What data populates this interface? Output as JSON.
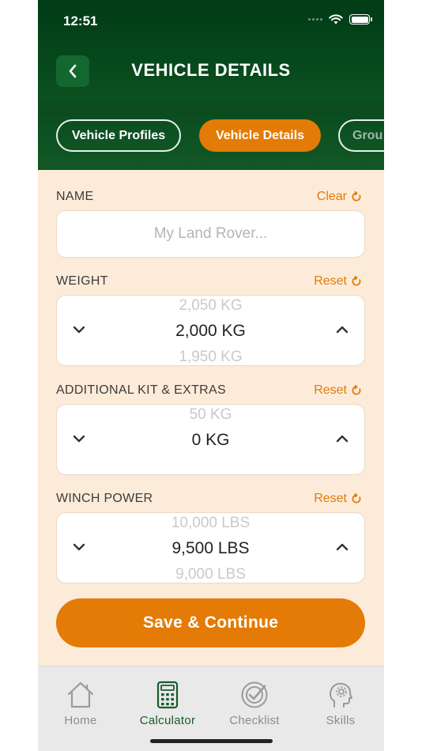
{
  "status_bar": {
    "time": "12:51"
  },
  "header": {
    "title": "VEHICLE DETAILS"
  },
  "tabs": [
    {
      "label": "Vehicle Profiles",
      "state": "inactive"
    },
    {
      "label": "Vehicle Details",
      "state": "active"
    },
    {
      "label": "Grou",
      "state": "inactive"
    }
  ],
  "name_section": {
    "label": "NAME",
    "action": "Clear",
    "placeholder": "My Land Rover..."
  },
  "weight_section": {
    "label": "WEIGHT",
    "action": "Reset",
    "prev": "2,050 KG",
    "current": "2,000 KG",
    "next": "1,950 KG"
  },
  "kit_section": {
    "label": "ADDITIONAL KIT & EXTRAS",
    "action": "Reset",
    "prev": "50 KG",
    "current": "0 KG",
    "next": ""
  },
  "winch_section": {
    "label": "WINCH POWER",
    "action": "Reset",
    "prev": "10,000 LBS",
    "current": "9,500 LBS",
    "next": "9,000 LBS"
  },
  "save_button": {
    "label": "Save & Continue"
  },
  "tab_bar": {
    "items": [
      {
        "label": "Home",
        "icon": "home-icon"
      },
      {
        "label": "Calculator",
        "icon": "calculator-icon",
        "active": true
      },
      {
        "label": "Checklist",
        "icon": "checklist-icon"
      },
      {
        "label": "Skills",
        "icon": "skills-icon"
      }
    ]
  },
  "colors": {
    "accent": "#e47b06",
    "header_green": "#0a4f1f",
    "background": "#fcebd9",
    "active_tab_text": "#1a5b2a"
  }
}
